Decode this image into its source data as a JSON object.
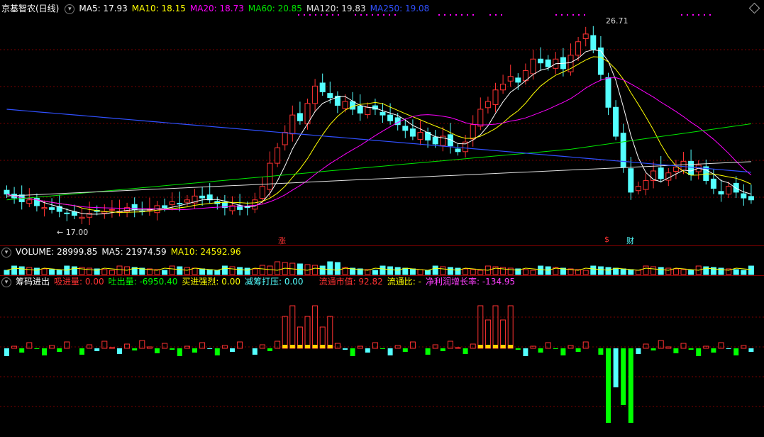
{
  "colors": {
    "up": "#ff3232",
    "down": "#54ffff",
    "ma5": "#ffffff",
    "ma10": "#ffff00",
    "ma20": "#ff00ff",
    "ma60": "#00e600",
    "ma120": "#e0e0e0",
    "ma250": "#3050ff",
    "grid": "#7a0000",
    "gold": "#ffd200",
    "green": "#00ff00",
    "pink": "#ff40ff"
  },
  "price": {
    "title": "京基智农(日线)",
    "ma5": "MA5: 17.93",
    "ma10": "MA10: 18.15",
    "ma20": "MA20: 18.73",
    "ma60": "MA60: 20.85",
    "ma120": "MA120: 19.83",
    "ma250": "MA250: 19.08",
    "high_label": "26.71",
    "low_label": "17.00",
    "mark_zhang": "涨",
    "mark_s": "$",
    "mark_cai": "财"
  },
  "volume": {
    "label": "VOLUME: 28999.85",
    "ma5": "MA5: 21974.59",
    "ma10": "MA10: 24592.96"
  },
  "chip": {
    "label": "筹码进出",
    "xijin": "吸进量: 0.00",
    "tuchu": "吐出量: -6950.40",
    "maijin": "买进强烈: 0.00",
    "jianchou": "减筹打压: 0.00",
    "liutong": "流通市值: 92.82",
    "liutongbi": "流通比: -",
    "jingli": "净利润增长率: -134.95"
  },
  "chart_data": {
    "type": "candlestick",
    "title": "京基智农(日线)",
    "price_high": 26.71,
    "price_low": 17.0,
    "close_series": [
      18.2,
      18.0,
      17.8,
      17.9,
      17.6,
      17.5,
      17.4,
      17.3,
      17.2,
      17.1,
      17.0,
      17.2,
      17.3,
      17.3,
      17.4,
      17.3,
      17.5,
      17.4,
      17.3,
      17.4,
      17.6,
      17.5,
      17.8,
      17.7,
      17.9,
      18.1,
      18.0,
      17.9,
      17.7,
      17.5,
      17.6,
      17.4,
      17.5,
      17.9,
      18.6,
      19.8,
      20.6,
      21.4,
      22.3,
      22.0,
      22.9,
      23.8,
      23.5,
      23.2,
      22.8,
      23.0,
      22.6,
      22.4,
      22.7,
      22.6,
      22.3,
      22.0,
      21.8,
      21.5,
      21.2,
      21.4,
      21.0,
      20.8,
      21.2,
      20.7,
      20.4,
      20.9,
      21.8,
      22.6,
      23.0,
      23.6,
      23.9,
      24.3,
      24.0,
      24.6,
      25.2,
      25.0,
      24.8,
      25.2,
      24.7,
      25.4,
      26.1,
      26.5,
      25.7,
      24.4,
      22.7,
      21.2,
      19.6,
      18.3,
      18.6,
      18.9,
      19.4,
      19.0,
      19.3,
      19.6,
      19.9,
      19.2,
      19.7,
      18.9,
      18.5,
      18.2,
      18.6,
      18.3,
      18.0,
      17.9
    ]
  }
}
